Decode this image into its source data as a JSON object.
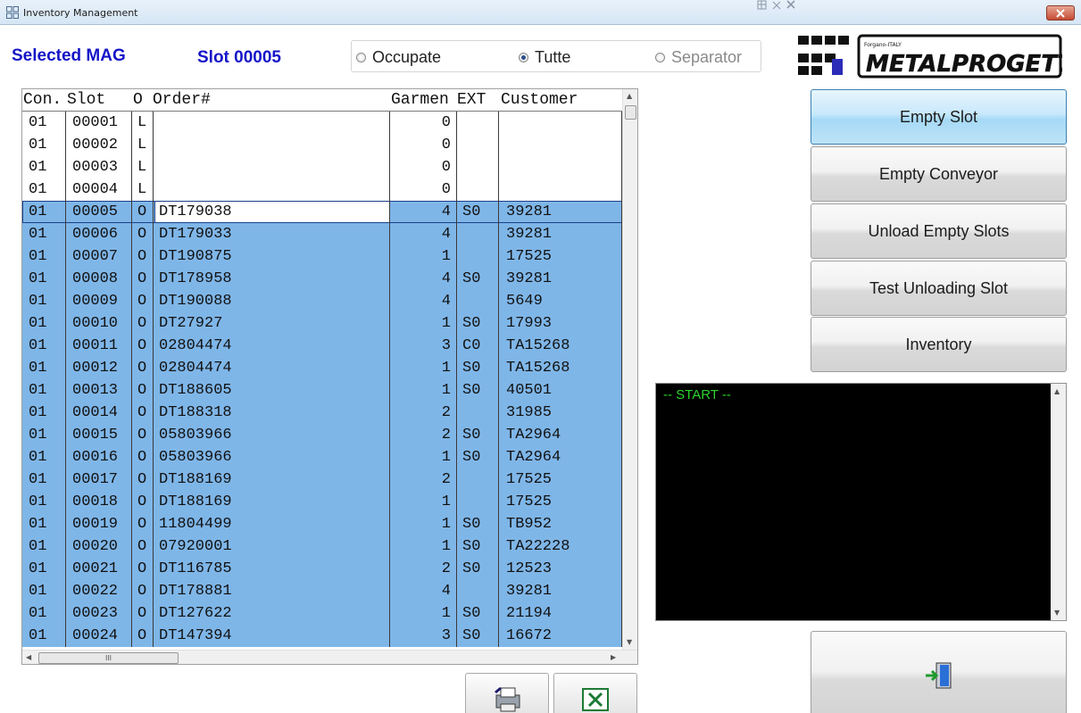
{
  "window": {
    "title": "Inventory Management"
  },
  "header": {
    "selected_label": "Selected MAG",
    "slot_label": "Slot 00005",
    "filter": {
      "options": [
        {
          "label": "Occupate",
          "checked": false,
          "enabled": true
        },
        {
          "label": "Tutte",
          "checked": true,
          "enabled": true
        },
        {
          "label": "Separator",
          "checked": false,
          "enabled": false
        }
      ]
    }
  },
  "logo": {
    "brand": "METALPROGETTI",
    "tagline": "Forgano-ITALY"
  },
  "grid": {
    "columns": [
      "Con.",
      "Slot",
      "O",
      "Order#",
      "Garmen",
      "EXT",
      "Customer"
    ],
    "rows": [
      {
        "con": "01",
        "slot": "00001",
        "o": "L",
        "order": "",
        "garments": "0",
        "ext": "",
        "customer": ""
      },
      {
        "con": "01",
        "slot": "00002",
        "o": "L",
        "order": "",
        "garments": "0",
        "ext": "",
        "customer": ""
      },
      {
        "con": "01",
        "slot": "00003",
        "o": "L",
        "order": "",
        "garments": "0",
        "ext": "",
        "customer": ""
      },
      {
        "con": "01",
        "slot": "00004",
        "o": "L",
        "order": "",
        "garments": "0",
        "ext": "",
        "customer": ""
      },
      {
        "con": "01",
        "slot": "00005",
        "o": "O",
        "order": "DT179038",
        "garments": "4",
        "ext": "S0",
        "customer": "39281"
      },
      {
        "con": "01",
        "slot": "00006",
        "o": "O",
        "order": "DT179033",
        "garments": "4",
        "ext": "",
        "customer": "39281"
      },
      {
        "con": "01",
        "slot": "00007",
        "o": "O",
        "order": "DT190875",
        "garments": "1",
        "ext": "",
        "customer": "17525"
      },
      {
        "con": "01",
        "slot": "00008",
        "o": "O",
        "order": "DT178958",
        "garments": "4",
        "ext": "S0",
        "customer": "39281"
      },
      {
        "con": "01",
        "slot": "00009",
        "o": "O",
        "order": "DT190088",
        "garments": "4",
        "ext": "",
        "customer": "5649"
      },
      {
        "con": "01",
        "slot": "00010",
        "o": "O",
        "order": "DT27927",
        "garments": "1",
        "ext": "S0",
        "customer": "17993"
      },
      {
        "con": "01",
        "slot": "00011",
        "o": "O",
        "order": "02804474",
        "garments": "3",
        "ext": "C0",
        "customer": "TA15268"
      },
      {
        "con": "01",
        "slot": "00012",
        "o": "O",
        "order": "02804474",
        "garments": "1",
        "ext": "S0",
        "customer": "TA15268"
      },
      {
        "con": "01",
        "slot": "00013",
        "o": "O",
        "order": "DT188605",
        "garments": "1",
        "ext": "S0",
        "customer": "40501"
      },
      {
        "con": "01",
        "slot": "00014",
        "o": "O",
        "order": "DT188318",
        "garments": "2",
        "ext": "",
        "customer": "31985"
      },
      {
        "con": "01",
        "slot": "00015",
        "o": "O",
        "order": "05803966",
        "garments": "2",
        "ext": "S0",
        "customer": "TA2964"
      },
      {
        "con": "01",
        "slot": "00016",
        "o": "O",
        "order": "05803966",
        "garments": "1",
        "ext": "S0",
        "customer": "TA2964"
      },
      {
        "con": "01",
        "slot": "00017",
        "o": "O",
        "order": "DT188169",
        "garments": "2",
        "ext": "",
        "customer": "17525"
      },
      {
        "con": "01",
        "slot": "00018",
        "o": "O",
        "order": "DT188169",
        "garments": "1",
        "ext": "",
        "customer": "17525"
      },
      {
        "con": "01",
        "slot": "00019",
        "o": "O",
        "order": "11804499",
        "garments": "1",
        "ext": "S0",
        "customer": "TB952"
      },
      {
        "con": "01",
        "slot": "00020",
        "o": "O",
        "order": "07920001",
        "garments": "1",
        "ext": "S0",
        "customer": "TA22228"
      },
      {
        "con": "01",
        "slot": "00021",
        "o": "O",
        "order": "DT116785",
        "garments": "2",
        "ext": "S0",
        "customer": "12523"
      },
      {
        "con": "01",
        "slot": "00022",
        "o": "O",
        "order": "DT178881",
        "garments": "4",
        "ext": "",
        "customer": "39281"
      },
      {
        "con": "01",
        "slot": "00023",
        "o": "O",
        "order": "DT127622",
        "garments": "1",
        "ext": "S0",
        "customer": "21194"
      },
      {
        "con": "01",
        "slot": "00024",
        "o": "O",
        "order": "DT147394",
        "garments": "3",
        "ext": "S0",
        "customer": "16672"
      }
    ]
  },
  "actions": {
    "empty_slot": "Empty Slot",
    "empty_conveyor": "Empty Conveyor",
    "unload_empty_slots": "Unload Empty Slots",
    "test_unloading_slot": "Test Unloading Slot",
    "inventory": "Inventory"
  },
  "console": {
    "text": "-- START --",
    "color": "#2bd42b"
  },
  "colors": {
    "header_text": "#1515c8",
    "row_selected": "#7fb6e8",
    "active_button": "#a6d9f6"
  },
  "icons": {
    "print": "printer-icon",
    "excel": "excel-icon",
    "exit": "exit-door-icon"
  }
}
